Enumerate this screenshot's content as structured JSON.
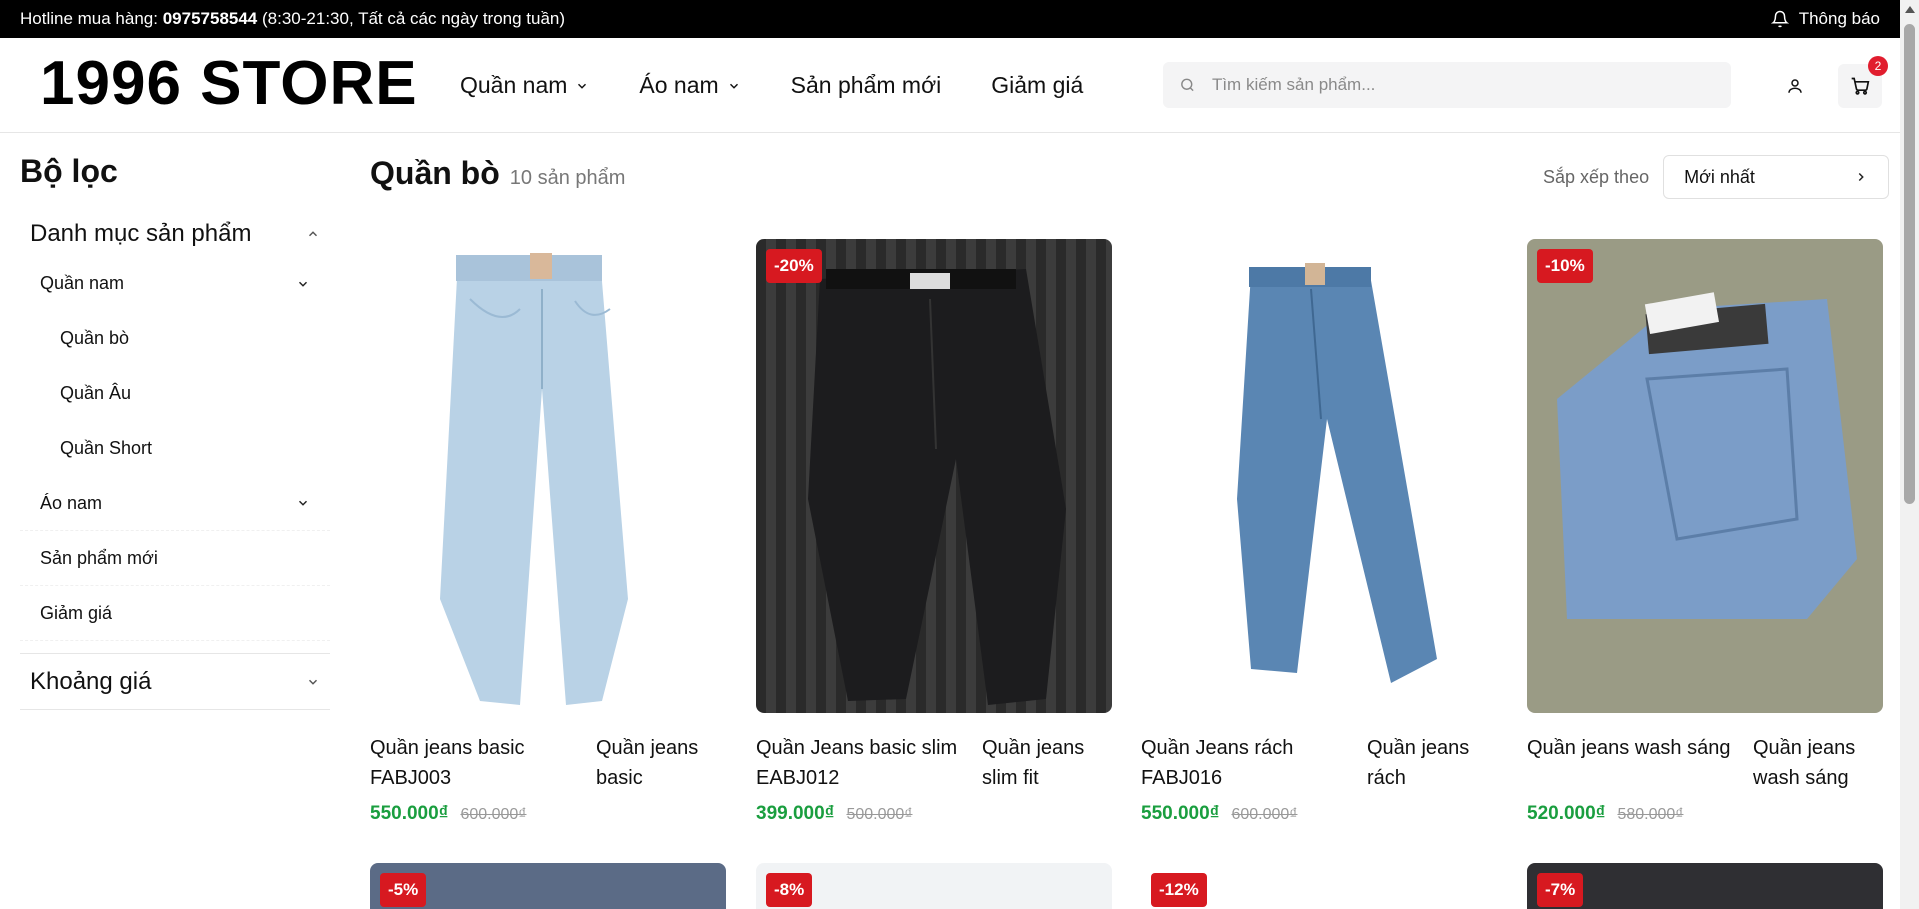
{
  "topbar": {
    "hotline_label": "Hotline mua hàng:",
    "hotline_number": "0975758544",
    "hotline_hours": "(8:30-21:30, Tất cả các ngày trong tuần)",
    "notify_label": "Thông báo"
  },
  "header": {
    "logo": "1996 STORE",
    "nav": [
      {
        "label": "Quần nam",
        "has_dropdown": true
      },
      {
        "label": "Áo nam",
        "has_dropdown": true
      },
      {
        "label": "Sản phẩm mới",
        "has_dropdown": false
      },
      {
        "label": "Giảm giá",
        "has_dropdown": false
      }
    ],
    "search_placeholder": "Tìm kiếm sản phẩm...",
    "cart_count": "2"
  },
  "sidebar": {
    "title": "Bộ lọc",
    "category_header": "Danh mục sản phẩm",
    "categories": {
      "quan_nam": "Quần nam",
      "quan_bo": "Quần bò",
      "quan_au": "Quần Âu",
      "quan_short": "Quần Short",
      "ao_nam": "Áo nam",
      "san_pham_moi": "Sản phẩm mới",
      "giam_gia": "Giảm giá"
    },
    "price_header": "Khoảng giá"
  },
  "main": {
    "title": "Quần bò",
    "count": "10 sản phẩm",
    "sort_label": "Sắp xếp theo",
    "sort_value": "Mới nhất"
  },
  "products": [
    {
      "name": "Quần jeans basic FABJ003",
      "category": "Quần jeans basic",
      "price": "550.000₫",
      "old_price": "600.000₫",
      "badge": "",
      "image": "light-jeans"
    },
    {
      "name": "Quần Jeans basic slim EABJ012",
      "category": "Quần jeans slim fit",
      "price": "399.000₫",
      "old_price": "500.000₫",
      "badge": "-20%",
      "image": "black-jeans"
    },
    {
      "name": "Quần Jeans rách FABJ016",
      "category": "Quần jeans rách",
      "price": "550.000₫",
      "old_price": "600.000₫",
      "badge": "",
      "image": "blue-jeans"
    },
    {
      "name": "Quần jeans wash sáng",
      "category": "Quần jeans wash sáng",
      "price": "520.000₫",
      "old_price": "580.000₫",
      "badge": "-10%",
      "image": "folded-jeans"
    }
  ],
  "next_row_badges": [
    "-5%",
    "-8%",
    "-12%",
    "-7%"
  ],
  "colors": {
    "accent_red": "#d71920",
    "price_green": "#1a9e3f",
    "badge_red": "#e11d2e"
  }
}
